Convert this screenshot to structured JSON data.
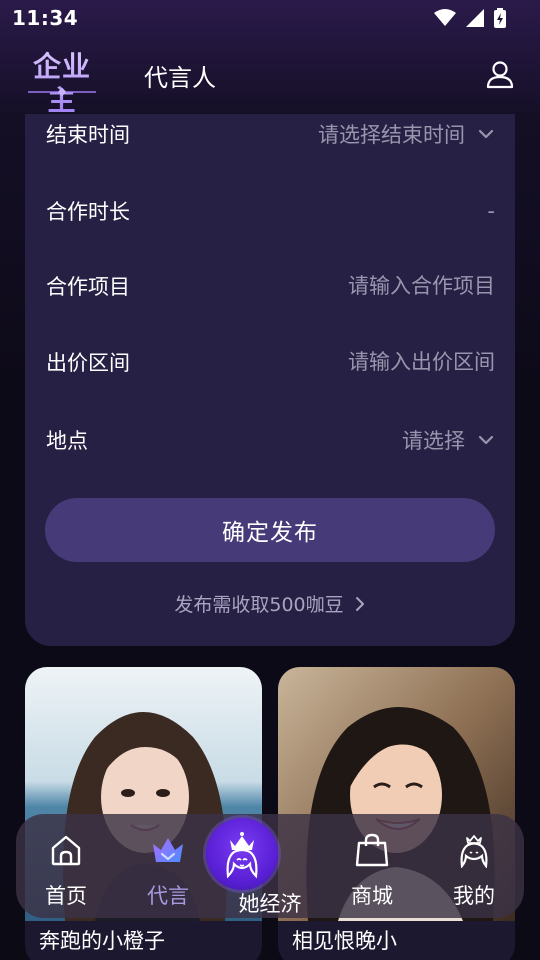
{
  "status_bar": {
    "time": "11:34",
    "icons": [
      "wifi-icon",
      "signal-icon",
      "battery-icon"
    ]
  },
  "header": {
    "brand": "企业主",
    "tab": "代言人",
    "profile_icon": "user-icon"
  },
  "form": {
    "rows": [
      {
        "label": "结束时间",
        "value": "请选择结束时间",
        "has_dropdown": true
      },
      {
        "label": "合作时长",
        "value": "-",
        "has_dropdown": false
      },
      {
        "label": "合作项目",
        "placeholder": "请输入合作项目"
      },
      {
        "label": "出价区间",
        "placeholder": "请输入出价区间"
      },
      {
        "label": "地点",
        "value": "请选择",
        "has_dropdown": true
      }
    ],
    "submit_label": "确定发布",
    "fee_note": "发布需收取500咖豆"
  },
  "profiles": [
    {
      "name": "奔跑的小橙子"
    },
    {
      "name": "相见恨晚小"
    }
  ],
  "nav": {
    "items": [
      {
        "label": "首页",
        "icon": "home-icon"
      },
      {
        "label": "代言",
        "icon": "crown-badge-icon",
        "active": true
      },
      {
        "label": "她经济",
        "icon": "queen-icon"
      },
      {
        "label": "商城",
        "icon": "shopping-bag-icon"
      },
      {
        "label": "我的",
        "icon": "person-icon"
      }
    ]
  },
  "colors": {
    "card_bg": "#262044",
    "button_bg": "#463a78",
    "active_nav": "#a89ae0",
    "center_button": "#5a20d6"
  }
}
